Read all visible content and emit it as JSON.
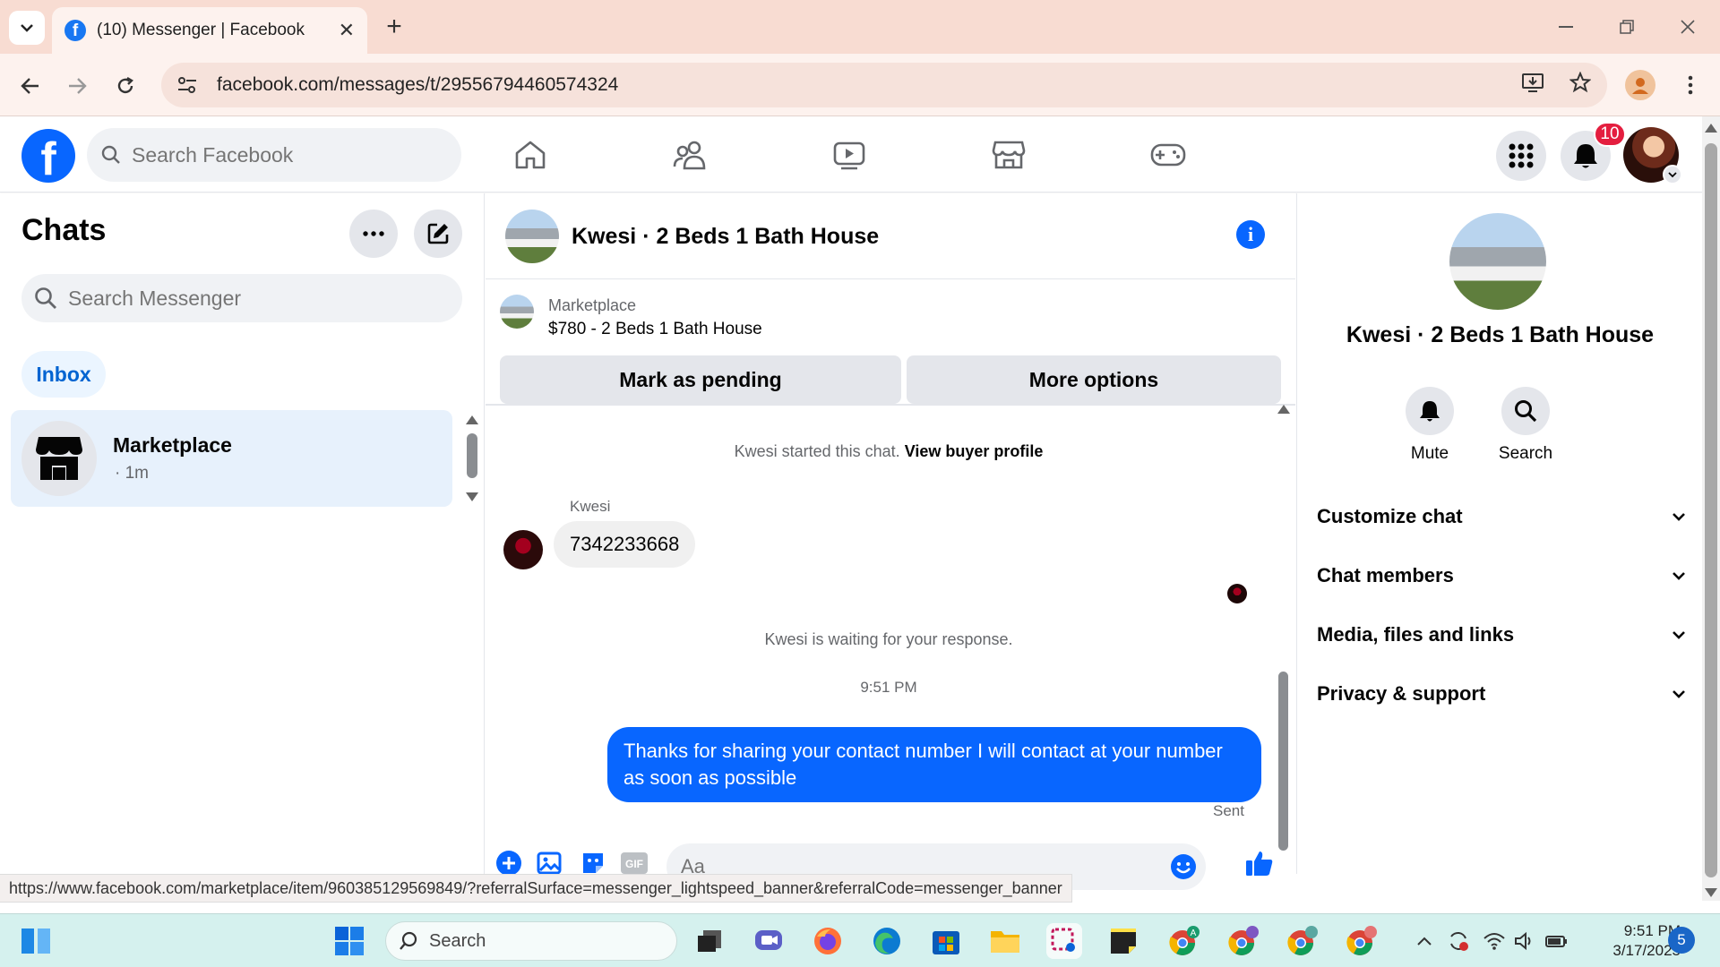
{
  "browser": {
    "tab_title": "(10) Messenger | Facebook",
    "tab_close": "✕",
    "new_tab": "+",
    "url": "facebook.com/messages/t/29556794460574324",
    "status_url": "https://www.facebook.com/marketplace/item/960385129569849/?referralSurface=messenger_lightspeed_banner&referralCode=messenger_banner"
  },
  "header": {
    "logo": "f",
    "search_placeholder": "Search Facebook",
    "notification_count": "10"
  },
  "chat_list": {
    "title": "Chats",
    "search_placeholder": "Search Messenger",
    "filter": "Inbox",
    "items": [
      {
        "name": "Marketplace",
        "time": "· 1m"
      }
    ]
  },
  "conversation": {
    "title": "Kwesi · 2 Beds 1 Bath House",
    "info": "i",
    "marketplace_label": "Marketplace",
    "listing": "$780 - 2 Beds 1 Bath House",
    "mark_pending": "Mark as pending",
    "more_options": "More options",
    "started_text": "Kwesi started this chat.",
    "view_profile": "View buyer profile",
    "sender": "Kwesi",
    "incoming": "7342233668",
    "waiting": "Kwesi is waiting for your response.",
    "timestamp": "9:51 PM",
    "outgoing": "Thanks for sharing your contact number I will contact at your number as soon as possible",
    "sent": "Sent",
    "composer_placeholder": "Aa"
  },
  "info_panel": {
    "title": "Kwesi · 2 Beds 1 Bath House",
    "mute": "Mute",
    "search": "Search",
    "sections": [
      "Customize chat",
      "Chat members",
      "Media, files and links",
      "Privacy & support"
    ]
  },
  "taskbar": {
    "search": "Search",
    "time": "9:51 PM",
    "date": "3/17/2025",
    "notifications": "5"
  },
  "colors": {
    "accent": "#0866ff",
    "tab_bar": "#f8dcd2",
    "taskbar": "#d5f1ee",
    "badge": "#e41e3f"
  }
}
